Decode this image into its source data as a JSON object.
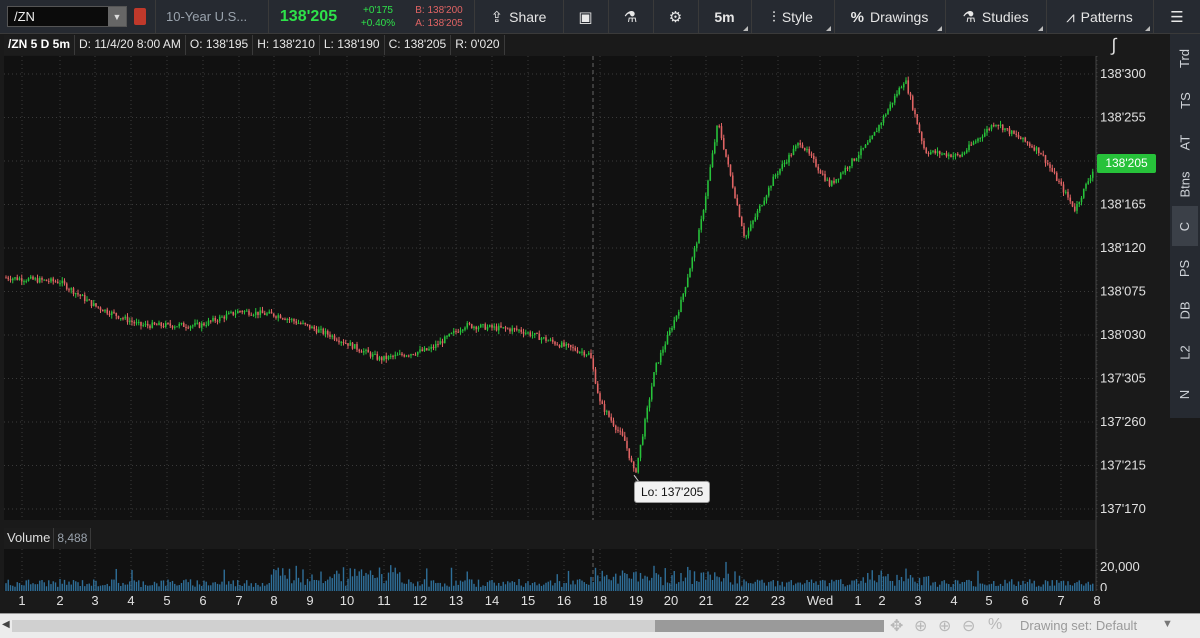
{
  "toolbar": {
    "symbol": "/ZN",
    "description": "10-Year U.S...",
    "last_price": "138'205",
    "net_change": "+0'175",
    "pct_change": "+0.40%",
    "bid": "B: 138'200",
    "ask": "A: 138'205",
    "share_label": "Share",
    "timeframe_label": "5m",
    "style_label": "Style",
    "drawings_label": "Drawings",
    "studies_label": "Studies",
    "patterns_label": "Patterns"
  },
  "info_bar": {
    "symbol_period": "/ZN 5 D 5m",
    "date": "D: 11/4/20 8:00 AM",
    "open": "O: 138'195",
    "high": "H: 138'210",
    "low": "L: 138'190",
    "close": "C: 138'205",
    "range": "R: 0'020"
  },
  "price_axis": [
    "138'300",
    "138'255",
    "138'210",
    "138'165",
    "138'120",
    "138'075",
    "138'030",
    "137'305",
    "137'260",
    "137'215",
    "137'170"
  ],
  "last_tag": "138'205",
  "low_label": "Lo: 137'205",
  "side_tabs": [
    "Trd",
    "TS",
    "AT",
    "Btns",
    "C",
    "PS",
    "DB",
    "L2",
    "N"
  ],
  "volume": {
    "label": "Volume",
    "value": "8,488",
    "axis_label": "20,000",
    "axis_zero": "0"
  },
  "time_axis": [
    "1",
    "2",
    "3",
    "4",
    "5",
    "6",
    "7",
    "8",
    "9",
    "10",
    "11",
    "12",
    "13",
    "14",
    "15",
    "16",
    "18",
    "19",
    "20",
    "21",
    "22",
    "23",
    "Wed",
    "1",
    "2",
    "3",
    "4",
    "5",
    "6",
    "7",
    "8"
  ],
  "bottom_bar": {
    "drawing_set": "Drawing set: Default"
  },
  "colors": {
    "up": "#27c23a",
    "down": "#e06464",
    "volume": "#2f6f9a",
    "grid": "#3a3a3a"
  },
  "chart_data": {
    "type": "candlestick",
    "symbol": "/ZN",
    "interval": "5m",
    "ylim": [
      "137'170",
      "138'300"
    ],
    "price_path": [
      [
        0,
        "138'090"
      ],
      [
        60,
        "138'085"
      ],
      [
        95,
        "138'060"
      ],
      [
        140,
        "138'040"
      ],
      [
        200,
        "138'040"
      ],
      [
        240,
        "138'055"
      ],
      [
        280,
        "138'050"
      ],
      [
        330,
        "138'030"
      ],
      [
        380,
        "138'005"
      ],
      [
        430,
        "138'015"
      ],
      [
        465,
        "138'040"
      ],
      [
        520,
        "138'035"
      ],
      [
        560,
        "138'020"
      ],
      [
        590,
        "138'010"
      ],
      [
        600,
        "137'280"
      ],
      [
        625,
        "137'240"
      ],
      [
        635,
        "137'205"
      ],
      [
        655,
        "137'315"
      ],
      [
        680,
        "138'060"
      ],
      [
        700,
        "138'140"
      ],
      [
        718,
        "138'250"
      ],
      [
        745,
        "138'130"
      ],
      [
        775,
        "138'195"
      ],
      [
        800,
        "138'230"
      ],
      [
        830,
        "138'185"
      ],
      [
        870,
        "138'230"
      ],
      [
        905,
        "138'295"
      ],
      [
        925,
        "138'220"
      ],
      [
        960,
        "138'215"
      ],
      [
        995,
        "138'250"
      ],
      [
        1040,
        "138'220"
      ],
      [
        1075,
        "138'160"
      ],
      [
        1095,
        "138'205"
      ]
    ]
  }
}
